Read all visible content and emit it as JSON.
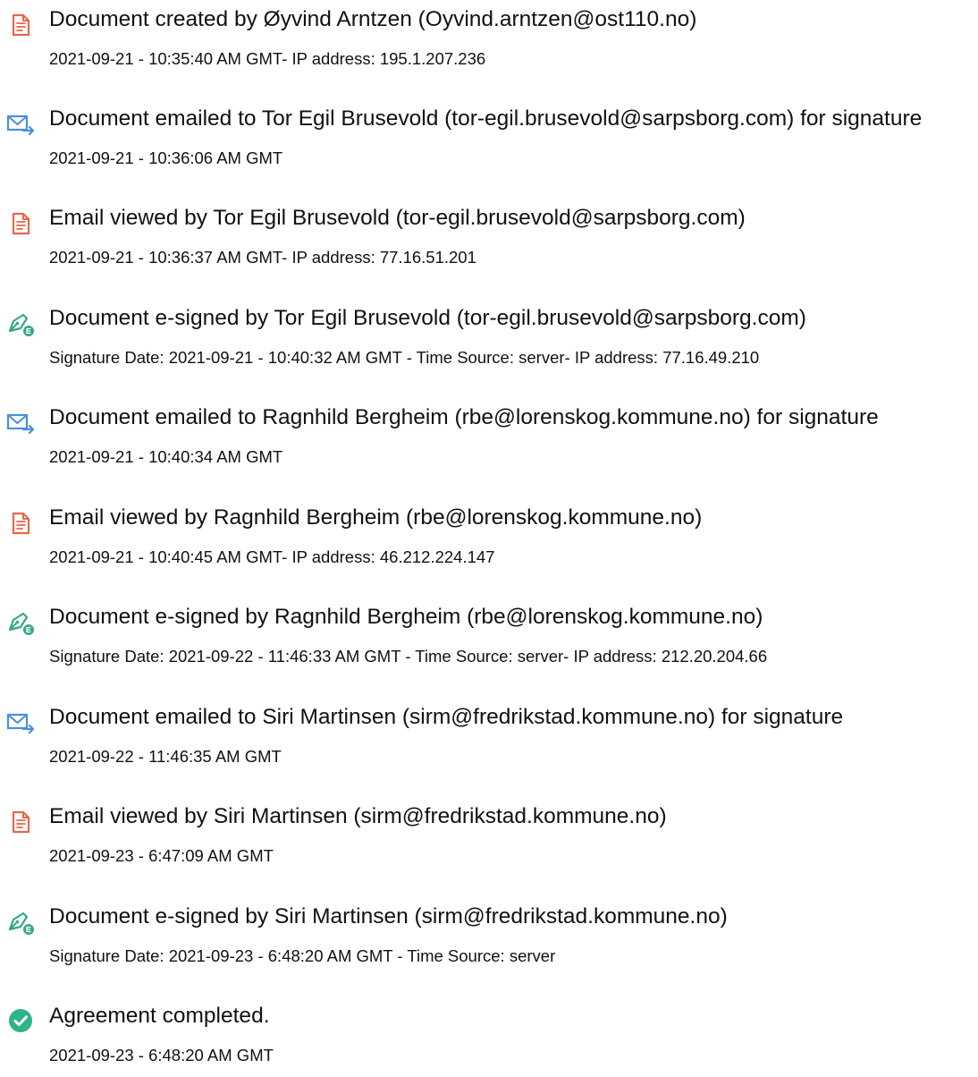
{
  "events": [
    {
      "icon": "document-created-icon",
      "title": "Document created by Øyvind Arntzen (Oyvind.arntzen@ost110.no)",
      "detail": "2021-09-21 - 10:35:40 AM GMT- IP address: 195.1.207.236"
    },
    {
      "icon": "email-sent-icon",
      "title": "Document emailed to Tor Egil Brusevold (tor-egil.brusevold@sarpsborg.com) for signature",
      "detail": "2021-09-21 - 10:36:06 AM GMT"
    },
    {
      "icon": "email-viewed-icon",
      "title": "Email viewed by Tor Egil Brusevold (tor-egil.brusevold@sarpsborg.com)",
      "detail": "2021-09-21 - 10:36:37 AM GMT- IP address: 77.16.51.201"
    },
    {
      "icon": "e-sign-icon",
      "title": "Document e-signed by Tor Egil Brusevold (tor-egil.brusevold@sarpsborg.com)",
      "detail": "Signature Date: 2021-09-21 - 10:40:32 AM GMT - Time Source: server- IP address: 77.16.49.210"
    },
    {
      "icon": "email-sent-icon",
      "title": "Document emailed to Ragnhild Bergheim (rbe@lorenskog.kommune.no) for signature",
      "detail": "2021-09-21 - 10:40:34 AM GMT"
    },
    {
      "icon": "email-viewed-icon",
      "title": "Email viewed by Ragnhild Bergheim (rbe@lorenskog.kommune.no)",
      "detail": "2021-09-21 - 10:40:45 AM GMT- IP address: 46.212.224.147"
    },
    {
      "icon": "e-sign-icon",
      "title": "Document e-signed by Ragnhild Bergheim (rbe@lorenskog.kommune.no)",
      "detail": "Signature Date: 2021-09-22 - 11:46:33 AM GMT - Time Source: server- IP address: 212.20.204.66"
    },
    {
      "icon": "email-sent-icon",
      "title": "Document emailed to Siri Martinsen (sirm@fredrikstad.kommune.no) for signature",
      "detail": "2021-09-22 - 11:46:35 AM GMT"
    },
    {
      "icon": "email-viewed-icon",
      "title": "Email viewed by Siri Martinsen (sirm@fredrikstad.kommune.no)",
      "detail": "2021-09-23 - 6:47:09 AM GMT"
    },
    {
      "icon": "e-sign-icon",
      "title": "Document e-signed by Siri Martinsen (sirm@fredrikstad.kommune.no)",
      "detail": "Signature Date: 2021-09-23 - 6:48:20 AM GMT - Time Source: server"
    },
    {
      "icon": "agreement-completed-icon",
      "title": "Agreement completed.",
      "detail": "2021-09-23 - 6:48:20 AM GMT"
    }
  ],
  "colors": {
    "document_icon": "#e8664a",
    "email_icon": "#4a90d9",
    "sign_icon": "#37a888",
    "completed_icon": "#2fb38a"
  }
}
